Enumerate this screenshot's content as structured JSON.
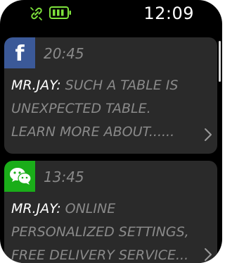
{
  "status_bar": {
    "time": "12:09",
    "link_icon": "link-icon",
    "battery_icon": "battery-icon",
    "accent_color": "#7ee23c"
  },
  "notifications": [
    {
      "app_icon": "facebook-icon",
      "icon_letter": "f",
      "icon_color": "#3b5998",
      "time": "20:45",
      "sender": "MR.JAY:",
      "message": " SUCH A TABLE IS\nUNEXPECTED TABLE.\nLEARN MORE ABOUT......"
    },
    {
      "app_icon": "wechat-icon",
      "icon_color": "#1aad19",
      "time": "13:45",
      "sender": "MR.JAY:",
      "message": " ONLINE\nPERSONALIZED SETTINGS,\nFREE DELIVERY SERVICE..."
    }
  ]
}
